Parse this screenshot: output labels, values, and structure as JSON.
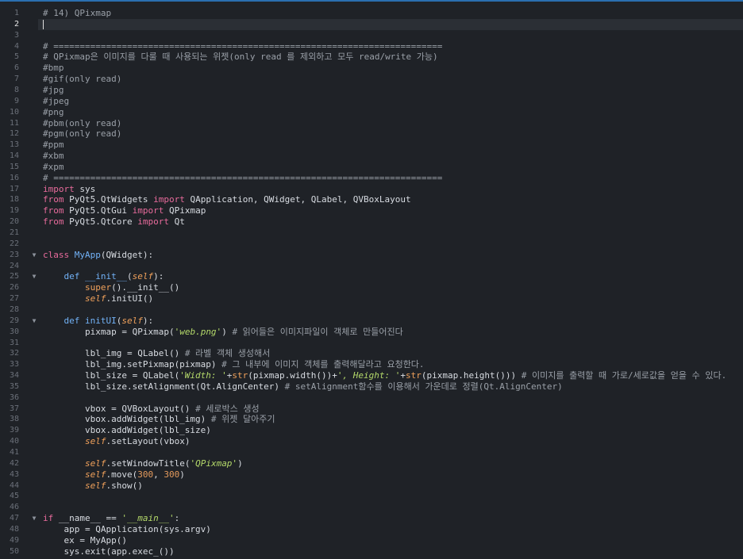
{
  "editor": {
    "active_line": 2,
    "lines": [
      {
        "n": "1",
        "fold": "",
        "segs": [
          {
            "t": "# 14) QPixmap",
            "c": "comment"
          }
        ]
      },
      {
        "n": "2",
        "fold": "",
        "segs": []
      },
      {
        "n": "3",
        "fold": "",
        "segs": []
      },
      {
        "n": "4",
        "fold": "",
        "segs": [
          {
            "t": "# ==========================================================================",
            "c": "comment"
          }
        ]
      },
      {
        "n": "5",
        "fold": "",
        "segs": [
          {
            "t": "# QPixmap은 이미지를 다룰 때 사용되는 위젯(only read 를 제외하고 모두 read/write 가능)",
            "c": "comment"
          }
        ]
      },
      {
        "n": "6",
        "fold": "",
        "segs": [
          {
            "t": "#bmp",
            "c": "comment"
          }
        ]
      },
      {
        "n": "7",
        "fold": "",
        "segs": [
          {
            "t": "#gif(only read)",
            "c": "comment"
          }
        ]
      },
      {
        "n": "8",
        "fold": "",
        "segs": [
          {
            "t": "#jpg",
            "c": "comment"
          }
        ]
      },
      {
        "n": "9",
        "fold": "",
        "segs": [
          {
            "t": "#jpeg",
            "c": "comment"
          }
        ]
      },
      {
        "n": "10",
        "fold": "",
        "segs": [
          {
            "t": "#png",
            "c": "comment"
          }
        ]
      },
      {
        "n": "11",
        "fold": "",
        "segs": [
          {
            "t": "#pbm(only read)",
            "c": "comment"
          }
        ]
      },
      {
        "n": "12",
        "fold": "",
        "segs": [
          {
            "t": "#pgm(only read)",
            "c": "comment"
          }
        ]
      },
      {
        "n": "13",
        "fold": "",
        "segs": [
          {
            "t": "#ppm",
            "c": "comment"
          }
        ]
      },
      {
        "n": "14",
        "fold": "",
        "segs": [
          {
            "t": "#xbm",
            "c": "comment"
          }
        ]
      },
      {
        "n": "15",
        "fold": "",
        "segs": [
          {
            "t": "#xpm",
            "c": "comment"
          }
        ]
      },
      {
        "n": "16",
        "fold": "",
        "segs": [
          {
            "t": "# ==========================================================================",
            "c": "comment"
          }
        ]
      },
      {
        "n": "17",
        "fold": "",
        "segs": [
          {
            "t": "import",
            "c": "kw"
          },
          {
            "t": " sys",
            "c": "plain"
          }
        ]
      },
      {
        "n": "18",
        "fold": "",
        "segs": [
          {
            "t": "from",
            "c": "kw"
          },
          {
            "t": " PyQt5.QtWidgets ",
            "c": "plain"
          },
          {
            "t": "import",
            "c": "kw"
          },
          {
            "t": " QApplication, QWidget, QLabel, QVBoxLayout",
            "c": "plain"
          }
        ]
      },
      {
        "n": "19",
        "fold": "",
        "segs": [
          {
            "t": "from",
            "c": "kw"
          },
          {
            "t": " PyQt5.QtGui ",
            "c": "plain"
          },
          {
            "t": "import",
            "c": "kw"
          },
          {
            "t": " QPixmap",
            "c": "plain"
          }
        ]
      },
      {
        "n": "20",
        "fold": "",
        "segs": [
          {
            "t": "from",
            "c": "kw"
          },
          {
            "t": " PyQt5.QtCore ",
            "c": "plain"
          },
          {
            "t": "import",
            "c": "kw"
          },
          {
            "t": " Qt",
            "c": "plain"
          }
        ]
      },
      {
        "n": "21",
        "fold": "",
        "segs": []
      },
      {
        "n": "22",
        "fold": "",
        "segs": []
      },
      {
        "n": "23",
        "fold": "▼",
        "segs": [
          {
            "t": "class",
            "c": "kw"
          },
          {
            "t": " MyApp",
            "c": "def"
          },
          {
            "t": "(QWidget):",
            "c": "plain"
          }
        ]
      },
      {
        "n": "24",
        "fold": "",
        "segs": []
      },
      {
        "n": "25",
        "fold": "▼",
        "segs": [
          {
            "t": "    def",
            "c": "def"
          },
          {
            "t": " __init__",
            "c": "def"
          },
          {
            "t": "(",
            "c": "plain"
          },
          {
            "t": "self",
            "c": "self"
          },
          {
            "t": "):",
            "c": "plain"
          }
        ]
      },
      {
        "n": "26",
        "fold": "",
        "segs": [
          {
            "t": "        ",
            "c": "plain"
          },
          {
            "t": "super",
            "c": "builtin"
          },
          {
            "t": "().__init__()",
            "c": "plain"
          }
        ]
      },
      {
        "n": "27",
        "fold": "",
        "segs": [
          {
            "t": "        ",
            "c": "plain"
          },
          {
            "t": "self",
            "c": "self"
          },
          {
            "t": ".initUI()",
            "c": "plain"
          }
        ]
      },
      {
        "n": "28",
        "fold": "",
        "segs": []
      },
      {
        "n": "29",
        "fold": "▼",
        "segs": [
          {
            "t": "    def",
            "c": "def"
          },
          {
            "t": " initUI",
            "c": "def"
          },
          {
            "t": "(",
            "c": "plain"
          },
          {
            "t": "self",
            "c": "self"
          },
          {
            "t": "):",
            "c": "plain"
          }
        ]
      },
      {
        "n": "30",
        "fold": "",
        "segs": [
          {
            "t": "        pixmap = QPixmap(",
            "c": "plain"
          },
          {
            "t": "'web.png'",
            "c": "str"
          },
          {
            "t": ") ",
            "c": "plain"
          },
          {
            "t": "# 읽어들은 이미지파일이 객체로 만들어진다",
            "c": "comment"
          }
        ]
      },
      {
        "n": "31",
        "fold": "",
        "segs": []
      },
      {
        "n": "32",
        "fold": "",
        "segs": [
          {
            "t": "        lbl_img = QLabel() ",
            "c": "plain"
          },
          {
            "t": "# 라벨 객체 생성해서",
            "c": "comment"
          }
        ]
      },
      {
        "n": "33",
        "fold": "",
        "segs": [
          {
            "t": "        lbl_img.setPixmap(pixmap) ",
            "c": "plain"
          },
          {
            "t": "# 그 내부에 이미지 객체를 출력해달라고 요청한다.",
            "c": "comment"
          }
        ]
      },
      {
        "n": "34",
        "fold": "",
        "segs": [
          {
            "t": "        lbl_size = QLabel(",
            "c": "plain"
          },
          {
            "t": "'Width: '",
            "c": "str"
          },
          {
            "t": "+",
            "c": "plain"
          },
          {
            "t": "str",
            "c": "builtin"
          },
          {
            "t": "(pixmap.width())+",
            "c": "plain"
          },
          {
            "t": "', Height: '",
            "c": "str"
          },
          {
            "t": "+",
            "c": "plain"
          },
          {
            "t": "str",
            "c": "builtin"
          },
          {
            "t": "(pixmap.height())) ",
            "c": "plain"
          },
          {
            "t": "# 이미지를 출력할 때 가로/세로값을 얻을 수 있다.",
            "c": "comment"
          }
        ]
      },
      {
        "n": "35",
        "fold": "",
        "segs": [
          {
            "t": "        lbl_size.setAlignment(Qt.AlignCenter) ",
            "c": "plain"
          },
          {
            "t": "# setAlignment함수를 이용해서 가운데로 정렬(Qt.AlignCenter)",
            "c": "comment"
          }
        ]
      },
      {
        "n": "36",
        "fold": "",
        "segs": []
      },
      {
        "n": "37",
        "fold": "",
        "segs": [
          {
            "t": "        vbox = QVBoxLayout() ",
            "c": "plain"
          },
          {
            "t": "# 세로박스 생성",
            "c": "comment"
          }
        ]
      },
      {
        "n": "38",
        "fold": "",
        "segs": [
          {
            "t": "        vbox.addWidget(lbl_img) ",
            "c": "plain"
          },
          {
            "t": "# 위젯 달아주기",
            "c": "comment"
          }
        ]
      },
      {
        "n": "39",
        "fold": "",
        "segs": [
          {
            "t": "        vbox.addWidget(lbl_size)",
            "c": "plain"
          }
        ]
      },
      {
        "n": "40",
        "fold": "",
        "segs": [
          {
            "t": "        ",
            "c": "plain"
          },
          {
            "t": "self",
            "c": "self"
          },
          {
            "t": ".setLayout(vbox)",
            "c": "plain"
          }
        ]
      },
      {
        "n": "41",
        "fold": "",
        "segs": []
      },
      {
        "n": "42",
        "fold": "",
        "segs": [
          {
            "t": "        ",
            "c": "plain"
          },
          {
            "t": "self",
            "c": "self"
          },
          {
            "t": ".setWindowTitle(",
            "c": "plain"
          },
          {
            "t": "'QPixmap'",
            "c": "str"
          },
          {
            "t": ")",
            "c": "plain"
          }
        ]
      },
      {
        "n": "43",
        "fold": "",
        "segs": [
          {
            "t": "        ",
            "c": "plain"
          },
          {
            "t": "self",
            "c": "self"
          },
          {
            "t": ".move(",
            "c": "plain"
          },
          {
            "t": "300",
            "c": "num"
          },
          {
            "t": ", ",
            "c": "plain"
          },
          {
            "t": "300",
            "c": "num"
          },
          {
            "t": ")",
            "c": "plain"
          }
        ]
      },
      {
        "n": "44",
        "fold": "",
        "segs": [
          {
            "t": "        ",
            "c": "plain"
          },
          {
            "t": "self",
            "c": "self"
          },
          {
            "t": ".show()",
            "c": "plain"
          }
        ]
      },
      {
        "n": "45",
        "fold": "",
        "segs": []
      },
      {
        "n": "46",
        "fold": "",
        "segs": []
      },
      {
        "n": "47",
        "fold": "▼",
        "segs": [
          {
            "t": "if",
            "c": "kw"
          },
          {
            "t": " __name__ == ",
            "c": "plain"
          },
          {
            "t": "'__main__'",
            "c": "str"
          },
          {
            "t": ":",
            "c": "plain"
          }
        ]
      },
      {
        "n": "48",
        "fold": "",
        "segs": [
          {
            "t": "    app = QApplication(sys.argv)",
            "c": "plain"
          }
        ]
      },
      {
        "n": "49",
        "fold": "",
        "segs": [
          {
            "t": "    ex = MyApp()",
            "c": "plain"
          }
        ]
      },
      {
        "n": "50",
        "fold": "",
        "segs": [
          {
            "t": "    sys.exit(app.exec_())",
            "c": "plain"
          }
        ]
      }
    ]
  }
}
